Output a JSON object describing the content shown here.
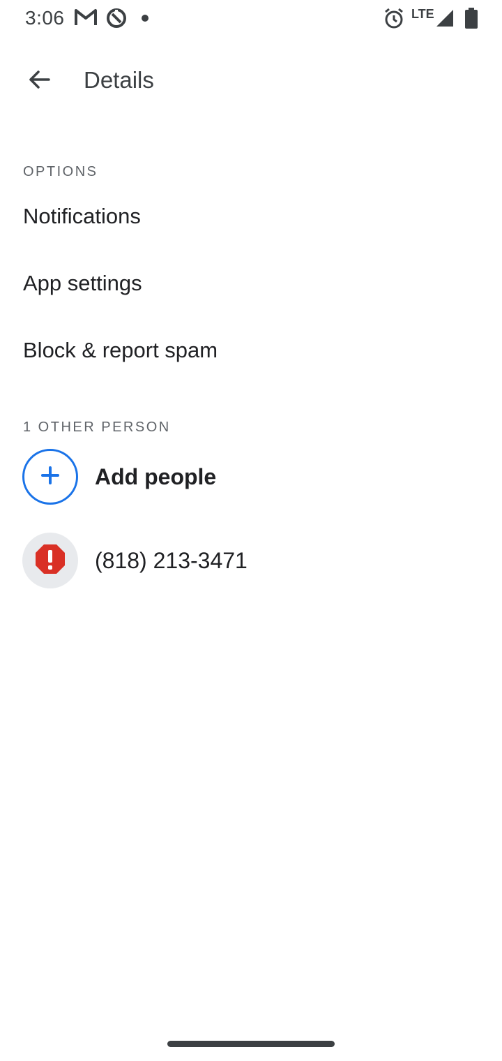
{
  "status_bar": {
    "time": "3:06",
    "network": "LTE",
    "icons": [
      "gmail-icon",
      "data-saver-icon",
      "notification-dot-icon",
      "alarm-icon",
      "signal-icon",
      "battery-icon"
    ]
  },
  "app_bar": {
    "title": "Details",
    "back_icon": "back-arrow-icon"
  },
  "options_section": {
    "header": "OPTIONS",
    "items": [
      {
        "label": "Notifications"
      },
      {
        "label": "App settings"
      },
      {
        "label": "Block & report spam"
      }
    ]
  },
  "people_section": {
    "header": "1 OTHER PERSON",
    "add_people_label": "Add people",
    "add_icon": "add-icon",
    "people": [
      {
        "label": "(818) 213-3471",
        "icon": "spam-warning-icon"
      }
    ]
  },
  "colors": {
    "accent": "#1a73e8",
    "spam_red": "#d93025",
    "avatar_bg": "#e8eaed",
    "text_primary": "#202124",
    "text_secondary": "#5f6368"
  }
}
